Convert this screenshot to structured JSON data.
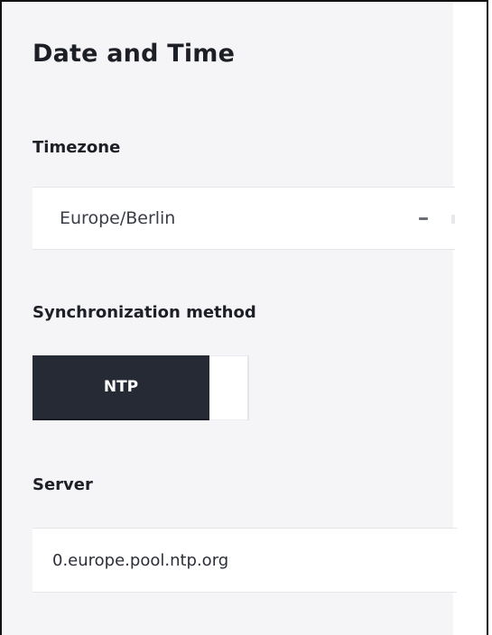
{
  "panel": {
    "title": "Date and Time"
  },
  "timezone": {
    "label": "Timezone",
    "selected": "Europe/Berlin",
    "caret_icon": "chevron-down-icon"
  },
  "sync": {
    "label": "Synchronization method",
    "options": [
      "NTP"
    ],
    "selected": "NTP"
  },
  "server": {
    "label": "Server",
    "value": "0.europe.pool.ntp.org"
  },
  "colors": {
    "background": "#f5f5f7",
    "selected_button": "#262a35",
    "text": "#1d1f26"
  }
}
